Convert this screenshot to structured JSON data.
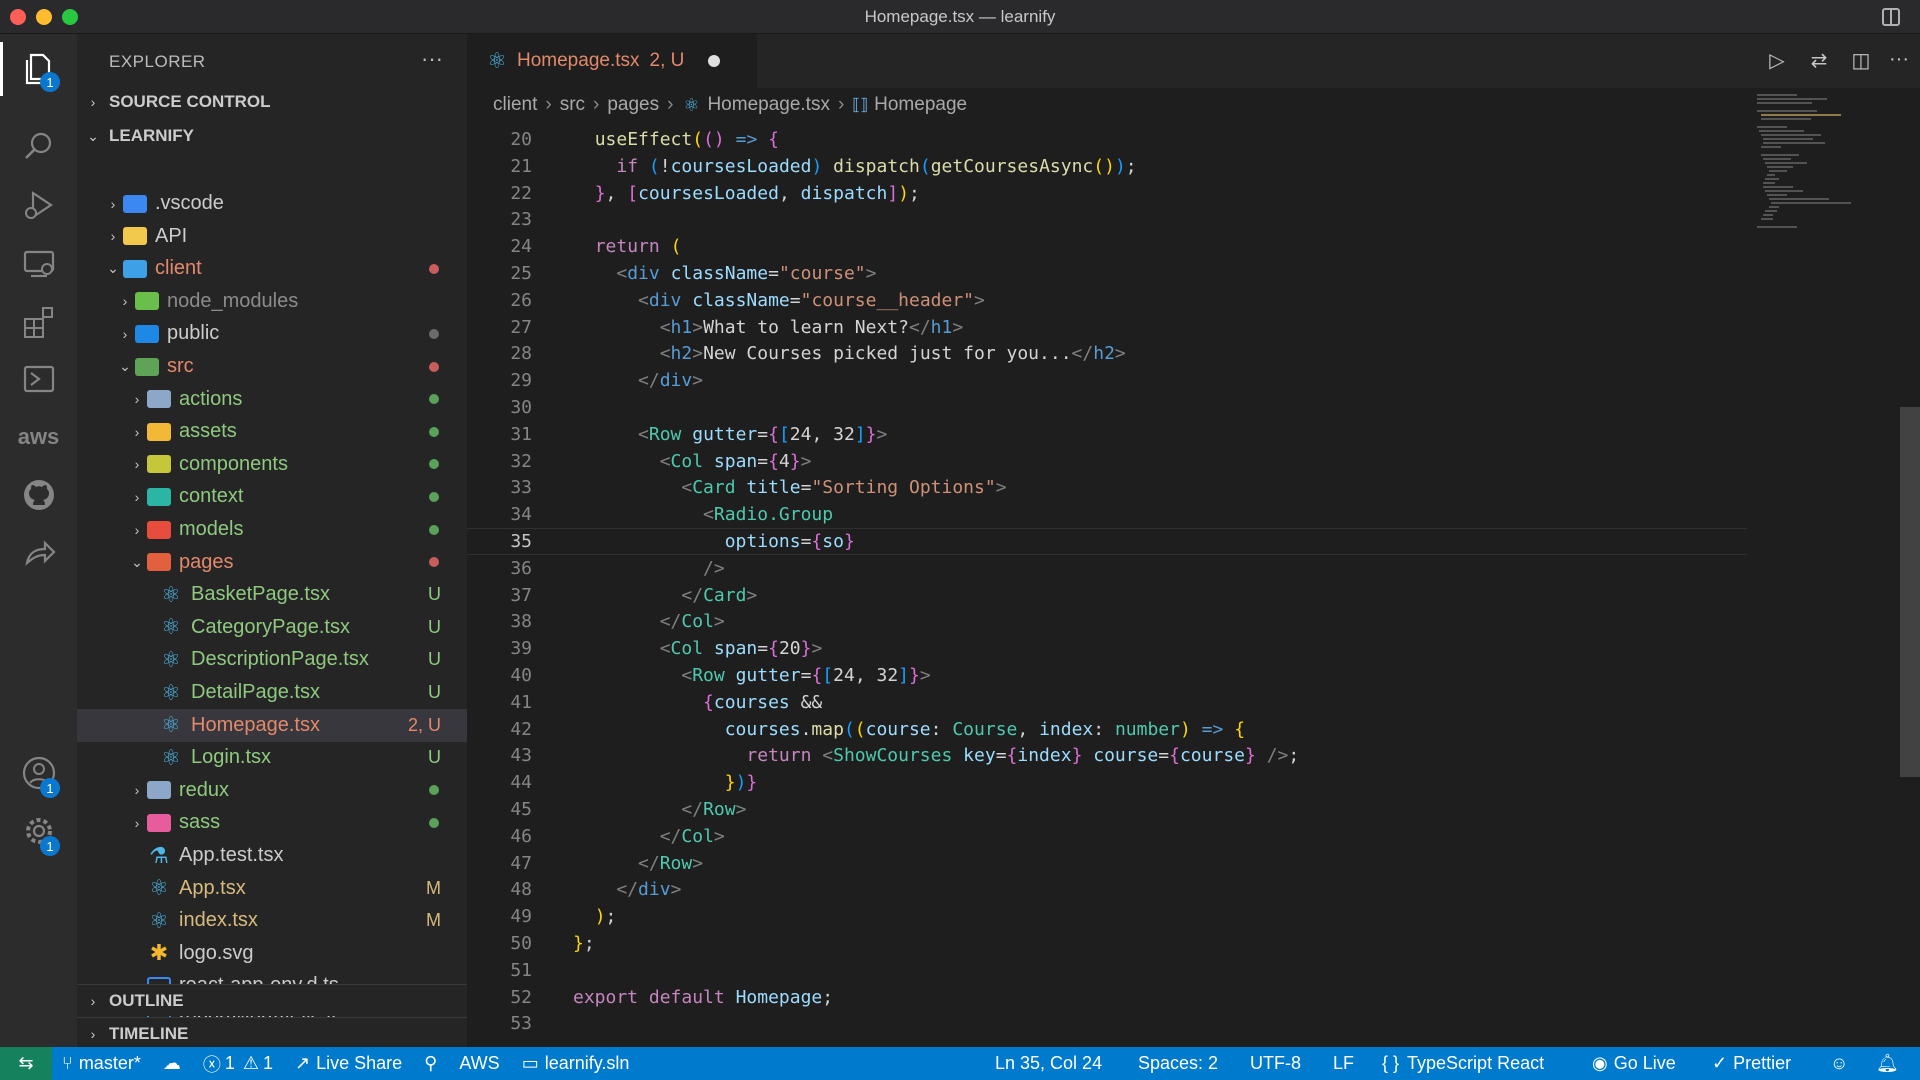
{
  "window": {
    "title": "Homepage.tsx — learnify"
  },
  "activity_bar": {
    "items": [
      {
        "icon": "files-icon",
        "badge": "1"
      },
      {
        "icon": "search-icon"
      },
      {
        "icon": "run-debug-icon"
      },
      {
        "icon": "remote-explorer-icon"
      },
      {
        "icon": "extensions-icon"
      },
      {
        "icon": "terminal-icon"
      },
      {
        "icon": "aws-icon",
        "label": "aws"
      },
      {
        "icon": "github-icon"
      },
      {
        "icon": "live-share-icon"
      }
    ],
    "accounts_badge": "1",
    "settings_badge": "1"
  },
  "sidebar": {
    "title": "EXPLORER",
    "more": "···",
    "sections": {
      "source_control": "SOURCE CONTROL",
      "workspace": "LEARNIFY",
      "outline": "OUTLINE",
      "timeline": "TIMELINE"
    },
    "tree": [
      {
        "name": ".vscode",
        "depth": 1,
        "kind": "folder",
        "color": "#3b88f0",
        "expanded": false
      },
      {
        "name": "API",
        "depth": 1,
        "kind": "folder",
        "color": "#f2c94c",
        "expanded": false
      },
      {
        "name": "client",
        "depth": 1,
        "kind": "folder",
        "color": "#3ea1e8",
        "expanded": true,
        "dot": "#c75d5d",
        "label_color": "#e2896b"
      },
      {
        "name": "node_modules",
        "depth": 2,
        "kind": "folder",
        "color": "#6abf4b",
        "expanded": false,
        "label_color": "#8b8b8b"
      },
      {
        "name": "public",
        "depth": 2,
        "kind": "folder",
        "color": "#1e88e5",
        "expanded": false,
        "dot": "#6b6b6b"
      },
      {
        "name": "src",
        "depth": 2,
        "kind": "folder",
        "color": "#5ea356",
        "expanded": true,
        "dot": "#c75d5d",
        "label_color": "#e2896b"
      },
      {
        "name": "actions",
        "depth": 3,
        "kind": "folder",
        "color": "#8ca7c7",
        "expanded": false,
        "dot": "#5aa25a",
        "label_color": "#8fc97f"
      },
      {
        "name": "assets",
        "depth": 3,
        "kind": "folder",
        "color": "#f2b838",
        "expanded": false,
        "dot": "#5aa25a",
        "label_color": "#8fc97f"
      },
      {
        "name": "components",
        "depth": 3,
        "kind": "folder",
        "color": "#c6c63a",
        "expanded": false,
        "dot": "#5aa25a",
        "label_color": "#8fc97f"
      },
      {
        "name": "context",
        "depth": 3,
        "kind": "folder",
        "color": "#2bb5a5",
        "expanded": false,
        "dot": "#5aa25a",
        "label_color": "#8fc97f"
      },
      {
        "name": "models",
        "depth": 3,
        "kind": "folder",
        "color": "#e74c3c",
        "expanded": false,
        "dot": "#5aa25a",
        "label_color": "#8fc97f"
      },
      {
        "name": "pages",
        "depth": 3,
        "kind": "folder",
        "color": "#e2603d",
        "expanded": true,
        "dot": "#c75d5d",
        "label_color": "#e2896b"
      },
      {
        "name": "BasketPage.tsx",
        "depth": 4,
        "kind": "react",
        "status": "U",
        "status_color": "#8fc97f",
        "label_color": "#8fc97f"
      },
      {
        "name": "CategoryPage.tsx",
        "depth": 4,
        "kind": "react",
        "status": "U",
        "status_color": "#8fc97f",
        "label_color": "#8fc97f"
      },
      {
        "name": "DescriptionPage.tsx",
        "depth": 4,
        "kind": "react",
        "status": "U",
        "status_color": "#8fc97f",
        "label_color": "#8fc97f"
      },
      {
        "name": "DetailPage.tsx",
        "depth": 4,
        "kind": "react",
        "status": "U",
        "status_color": "#8fc97f",
        "label_color": "#8fc97f"
      },
      {
        "name": "Homepage.tsx",
        "depth": 4,
        "kind": "react",
        "status": "2, U",
        "status_color": "#e2896b",
        "label_color": "#e2896b",
        "selected": true
      },
      {
        "name": "Login.tsx",
        "depth": 4,
        "kind": "react",
        "status": "U",
        "status_color": "#8fc97f",
        "label_color": "#8fc97f"
      },
      {
        "name": "redux",
        "depth": 3,
        "kind": "folder",
        "color": "#8ca7c7",
        "expanded": false,
        "dot": "#5aa25a",
        "label_color": "#8fc97f"
      },
      {
        "name": "sass",
        "depth": 3,
        "kind": "folder",
        "color": "#e65c9c",
        "expanded": false,
        "dot": "#5aa25a",
        "label_color": "#8fc97f"
      },
      {
        "name": "App.test.tsx",
        "depth": 3,
        "kind": "test"
      },
      {
        "name": "App.tsx",
        "depth": 3,
        "kind": "react",
        "status": "M",
        "status_color": "#d7ba7d",
        "label_color": "#d7ba7d"
      },
      {
        "name": "index.tsx",
        "depth": 3,
        "kind": "react",
        "status": "M",
        "status_color": "#d7ba7d",
        "label_color": "#d7ba7d"
      },
      {
        "name": "logo.svg",
        "depth": 3,
        "kind": "svg"
      },
      {
        "name": "react-app-env.d.ts",
        "depth": 3,
        "kind": "ts"
      },
      {
        "name": "reportWebVitals.ts",
        "depth": 3,
        "kind": "ts"
      }
    ]
  },
  "editor": {
    "tab": {
      "label": "Homepage.tsx",
      "status": "2, U"
    },
    "breadcrumb": [
      "client",
      "src",
      "pages",
      "Homepage.tsx",
      "Homepage"
    ],
    "current_line": 35,
    "lines": [
      {
        "n": "20",
        "html": "  <span class='f'>useEffect</span><span class='b1'>(</span><span class='b2'>()</span> <span class='k'>=&gt;</span> <span class='b2'>{</span>"
      },
      {
        "n": "21",
        "html": "    <span class='kp'>if</span> <span class='b3'>(</span>!<span class='v'>coursesLoaded</span><span class='b3'>)</span> <span class='f'>dispatch</span><span class='b3'>(</span><span class='f'>getCoursesAsync</span><span class='b1'>()</span><span class='b3'>)</span>;"
      },
      {
        "n": "22",
        "html": "  <span class='b2'>}</span>, <span class='b2'>[</span><span class='v'>coursesLoaded</span>, <span class='v'>dispatch</span><span class='b2'>]</span><span class='b1'>)</span>;"
      },
      {
        "n": "23",
        "html": ""
      },
      {
        "n": "24",
        "html": "  <span class='kp'>return</span> <span class='b1'>(</span>"
      },
      {
        "n": "25",
        "html": "    <span class='p'>&lt;</span><span class='t'>div</span> <span class='a'>className</span>=<span class='s'>\"course\"</span><span class='p'>&gt;</span>"
      },
      {
        "n": "26",
        "html": "      <span class='p'>&lt;</span><span class='t'>div</span> <span class='a'>className</span>=<span class='s'>\"course__header\"</span><span class='p'>&gt;</span>"
      },
      {
        "n": "27",
        "html": "        <span class='p'>&lt;</span><span class='t'>h1</span><span class='p'>&gt;</span>What to learn Next?<span class='p'>&lt;/</span><span class='t'>h1</span><span class='p'>&gt;</span>"
      },
      {
        "n": "28",
        "html": "        <span class='p'>&lt;</span><span class='t'>h2</span><span class='p'>&gt;</span>New Courses picked just for you...<span class='p'>&lt;/</span><span class='t'>h2</span><span class='p'>&gt;</span>"
      },
      {
        "n": "29",
        "html": "      <span class='p'>&lt;/</span><span class='t'>div</span><span class='p'>&gt;</span>"
      },
      {
        "n": "30",
        "html": ""
      },
      {
        "n": "31",
        "html": "      <span class='p'>&lt;</span><span class='c'>Row</span> <span class='a'>gutter</span>=<span class='b2'>{</span><span class='b3'>[</span>24, 32<span class='b3'>]</span><span class='b2'>}</span><span class='p'>&gt;</span>"
      },
      {
        "n": "32",
        "html": "        <span class='p'>&lt;</span><span class='c'>Col</span> <span class='a'>span</span>=<span class='b2'>{</span>4<span class='b2'>}</span><span class='p'>&gt;</span>"
      },
      {
        "n": "33",
        "html": "          <span class='p'>&lt;</span><span class='c'>Card</span> <span class='a'>title</span>=<span class='s'>\"Sorting Options\"</span><span class='p'>&gt;</span>"
      },
      {
        "n": "34",
        "html": "            <span class='p'>&lt;</span><span class='c'>Radio.Group</span>"
      },
      {
        "n": "35",
        "html": "              <span class='a'>options</span>=<span class='b2'>{</span><span class='v'>so</span><span class='b2'>}</span>"
      },
      {
        "n": "36",
        "html": "            <span class='p'>/&gt;</span>"
      },
      {
        "n": "37",
        "html": "          <span class='p'>&lt;/</span><span class='c'>Card</span><span class='p'>&gt;</span>"
      },
      {
        "n": "38",
        "html": "        <span class='p'>&lt;/</span><span class='c'>Col</span><span class='p'>&gt;</span>"
      },
      {
        "n": "39",
        "html": "        <span class='p'>&lt;</span><span class='c'>Col</span> <span class='a'>span</span>=<span class='b2'>{</span>20<span class='b2'>}</span><span class='p'>&gt;</span>"
      },
      {
        "n": "40",
        "html": "          <span class='p'>&lt;</span><span class='c'>Row</span> <span class='a'>gutter</span>=<span class='b2'>{</span><span class='b3'>[</span>24, 32<span class='b3'>]</span><span class='b2'>}</span><span class='p'>&gt;</span>"
      },
      {
        "n": "41",
        "html": "            <span class='b2'>{</span><span class='v'>courses</span> &amp;&amp;"
      },
      {
        "n": "42",
        "html": "              <span class='v'>courses</span>.<span class='f'>map</span><span class='b3'>(</span><span class='b1'>(</span><span class='v'>course</span>: <span class='c'>Course</span>, <span class='v'>index</span>: <span class='c'>number</span><span class='b1'>)</span> <span class='k'>=&gt;</span> <span class='b1'>{</span>"
      },
      {
        "n": "43",
        "html": "                <span class='kp'>return</span> <span class='p'>&lt;</span><span class='c'>ShowCourses</span> <span class='a'>key</span>=<span class='b2'>{</span><span class='v'>index</span><span class='b2'>}</span> <span class='a'>course</span>=<span class='b2'>{</span><span class='v'>course</span><span class='b2'>}</span> <span class='p'>/&gt;</span>;"
      },
      {
        "n": "44",
        "html": "              <span class='b1'>}</span><span class='b3'>)</span><span class='b2'>}</span>"
      },
      {
        "n": "45",
        "html": "          <span class='p'>&lt;/</span><span class='c'>Row</span><span class='p'>&gt;</span>"
      },
      {
        "n": "46",
        "html": "        <span class='p'>&lt;/</span><span class='c'>Col</span><span class='p'>&gt;</span>"
      },
      {
        "n": "47",
        "html": "      <span class='p'>&lt;/</span><span class='c'>Row</span><span class='p'>&gt;</span>"
      },
      {
        "n": "48",
        "html": "    <span class='p'>&lt;/</span><span class='t'>div</span><span class='p'>&gt;</span>"
      },
      {
        "n": "49",
        "html": "  <span class='b1'>)</span>;"
      },
      {
        "n": "50",
        "html": "<span class='b1'>}</span>;"
      },
      {
        "n": "51",
        "html": ""
      },
      {
        "n": "52",
        "html": "<span class='kp'>export</span> <span class='kp'>default</span> <span class='v'>Homepage</span>;"
      },
      {
        "n": "53",
        "html": ""
      }
    ]
  },
  "statusbar": {
    "branch": "master*",
    "errors": "1",
    "warnings": "1",
    "live_share": "Live Share",
    "aws": "AWS",
    "solution": "learnify.sln",
    "position": "Ln 35, Col 24",
    "spaces": "Spaces: 2",
    "encoding": "UTF-8",
    "eol": "LF",
    "language": "TypeScript React",
    "go_live": "Go Live",
    "prettier": "Prettier"
  }
}
